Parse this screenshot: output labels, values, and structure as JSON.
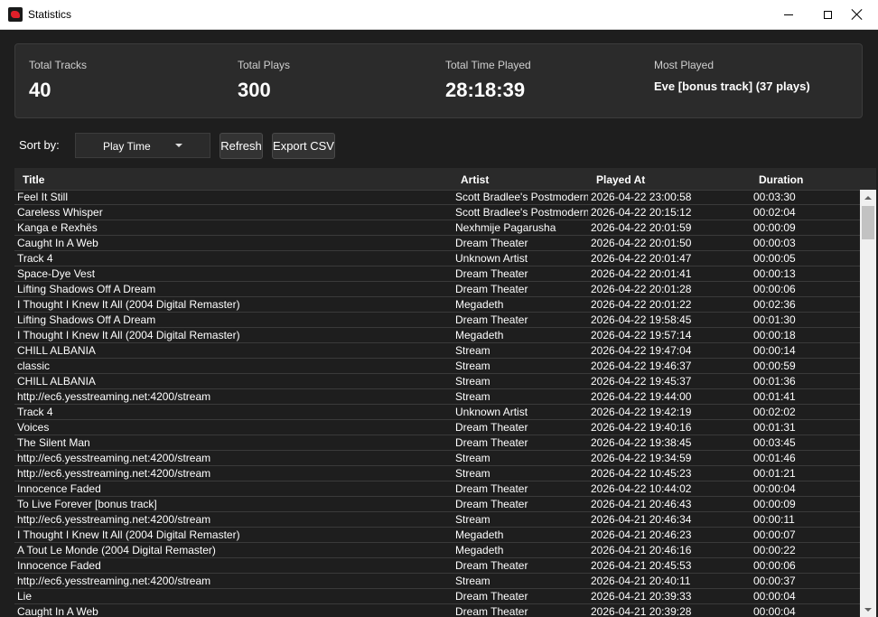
{
  "window": {
    "title": "Statistics"
  },
  "summary": {
    "total_tracks": {
      "label": "Total Tracks",
      "value": "40"
    },
    "total_plays": {
      "label": "Total Plays",
      "value": "300"
    },
    "total_time": {
      "label": "Total Time Played",
      "value": "28:18:39"
    },
    "most_played": {
      "label": "Most Played",
      "value": "Eve [bonus track] (37 plays)"
    }
  },
  "toolbar": {
    "sort_label": "Sort by:",
    "sort_value": "Play Time",
    "refresh_label": "Refresh",
    "export_label": "Export CSV"
  },
  "table": {
    "columns": {
      "title": "Title",
      "artist": "Artist",
      "played_at": "Played At",
      "duration": "Duration"
    },
    "rows": [
      {
        "title": "Feel It Still",
        "artist": "Scott Bradlee's Postmodern",
        "played_at": "2026-04-22 23:00:58",
        "duration": "00:03:30"
      },
      {
        "title": "Careless Whisper",
        "artist": "Scott Bradlee's Postmodern",
        "played_at": "2026-04-22 20:15:12",
        "duration": "00:02:04"
      },
      {
        "title": "Kanga e Rexhës",
        "artist": "Nexhmije Pagarusha",
        "played_at": "2026-04-22 20:01:59",
        "duration": "00:00:09"
      },
      {
        "title": "Caught In A Web",
        "artist": "Dream Theater",
        "played_at": "2026-04-22 20:01:50",
        "duration": "00:00:03"
      },
      {
        "title": "Track 4",
        "artist": "Unknown Artist",
        "played_at": "2026-04-22 20:01:47",
        "duration": "00:00:05"
      },
      {
        "title": "Space-Dye Vest",
        "artist": "Dream Theater",
        "played_at": "2026-04-22 20:01:41",
        "duration": "00:00:13"
      },
      {
        "title": "Lifting Shadows Off A Dream",
        "artist": "Dream Theater",
        "played_at": "2026-04-22 20:01:28",
        "duration": "00:00:06"
      },
      {
        "title": "I Thought I Knew It All (2004 Digital Remaster)",
        "artist": "Megadeth",
        "played_at": "2026-04-22 20:01:22",
        "duration": "00:02:36"
      },
      {
        "title": "Lifting Shadows Off A Dream",
        "artist": "Dream Theater",
        "played_at": "2026-04-22 19:58:45",
        "duration": "00:01:30"
      },
      {
        "title": "I Thought I Knew It All (2004 Digital Remaster)",
        "artist": "Megadeth",
        "played_at": "2026-04-22 19:57:14",
        "duration": "00:00:18"
      },
      {
        "title": "CHILL ALBANIA",
        "artist": "Stream",
        "played_at": "2026-04-22 19:47:04",
        "duration": "00:00:14"
      },
      {
        "title": "classic",
        "artist": "Stream",
        "played_at": "2026-04-22 19:46:37",
        "duration": "00:00:59"
      },
      {
        "title": "CHILL ALBANIA",
        "artist": "Stream",
        "played_at": "2026-04-22 19:45:37",
        "duration": "00:01:36"
      },
      {
        "title": "http://ec6.yesstreaming.net:4200/stream",
        "artist": "Stream",
        "played_at": "2026-04-22 19:44:00",
        "duration": "00:01:41"
      },
      {
        "title": "Track 4",
        "artist": "Unknown Artist",
        "played_at": "2026-04-22 19:42:19",
        "duration": "00:02:02"
      },
      {
        "title": "Voices",
        "artist": "Dream Theater",
        "played_at": "2026-04-22 19:40:16",
        "duration": "00:01:31"
      },
      {
        "title": "The Silent Man",
        "artist": "Dream Theater",
        "played_at": "2026-04-22 19:38:45",
        "duration": "00:03:45"
      },
      {
        "title": "http://ec6.yesstreaming.net:4200/stream",
        "artist": "Stream",
        "played_at": "2026-04-22 19:34:59",
        "duration": "00:01:46"
      },
      {
        "title": "http://ec6.yesstreaming.net:4200/stream",
        "artist": "Stream",
        "played_at": "2026-04-22 10:45:23",
        "duration": "00:01:21"
      },
      {
        "title": "Innocence Faded",
        "artist": "Dream Theater",
        "played_at": "2026-04-22 10:44:02",
        "duration": "00:00:04"
      },
      {
        "title": "To Live Forever [bonus track]",
        "artist": "Dream Theater",
        "played_at": "2026-04-21 20:46:43",
        "duration": "00:00:09"
      },
      {
        "title": "http://ec6.yesstreaming.net:4200/stream",
        "artist": "Stream",
        "played_at": "2026-04-21 20:46:34",
        "duration": "00:00:11"
      },
      {
        "title": "I Thought I Knew It All (2004 Digital Remaster)",
        "artist": "Megadeth",
        "played_at": "2026-04-21 20:46:23",
        "duration": "00:00:07"
      },
      {
        "title": "A Tout Le Monde (2004 Digital Remaster)",
        "artist": "Megadeth",
        "played_at": "2026-04-21 20:46:16",
        "duration": "00:00:22"
      },
      {
        "title": "Innocence Faded",
        "artist": "Dream Theater",
        "played_at": "2026-04-21 20:45:53",
        "duration": "00:00:06"
      },
      {
        "title": "http://ec6.yesstreaming.net:4200/stream",
        "artist": "Stream",
        "played_at": "2026-04-21 20:40:11",
        "duration": "00:00:37"
      },
      {
        "title": "Lie",
        "artist": "Dream Theater",
        "played_at": "2026-04-21 20:39:33",
        "duration": "00:00:04"
      },
      {
        "title": "Caught In A Web",
        "artist": "Dream Theater",
        "played_at": "2026-04-21 20:39:28",
        "duration": "00:00:04"
      }
    ]
  }
}
